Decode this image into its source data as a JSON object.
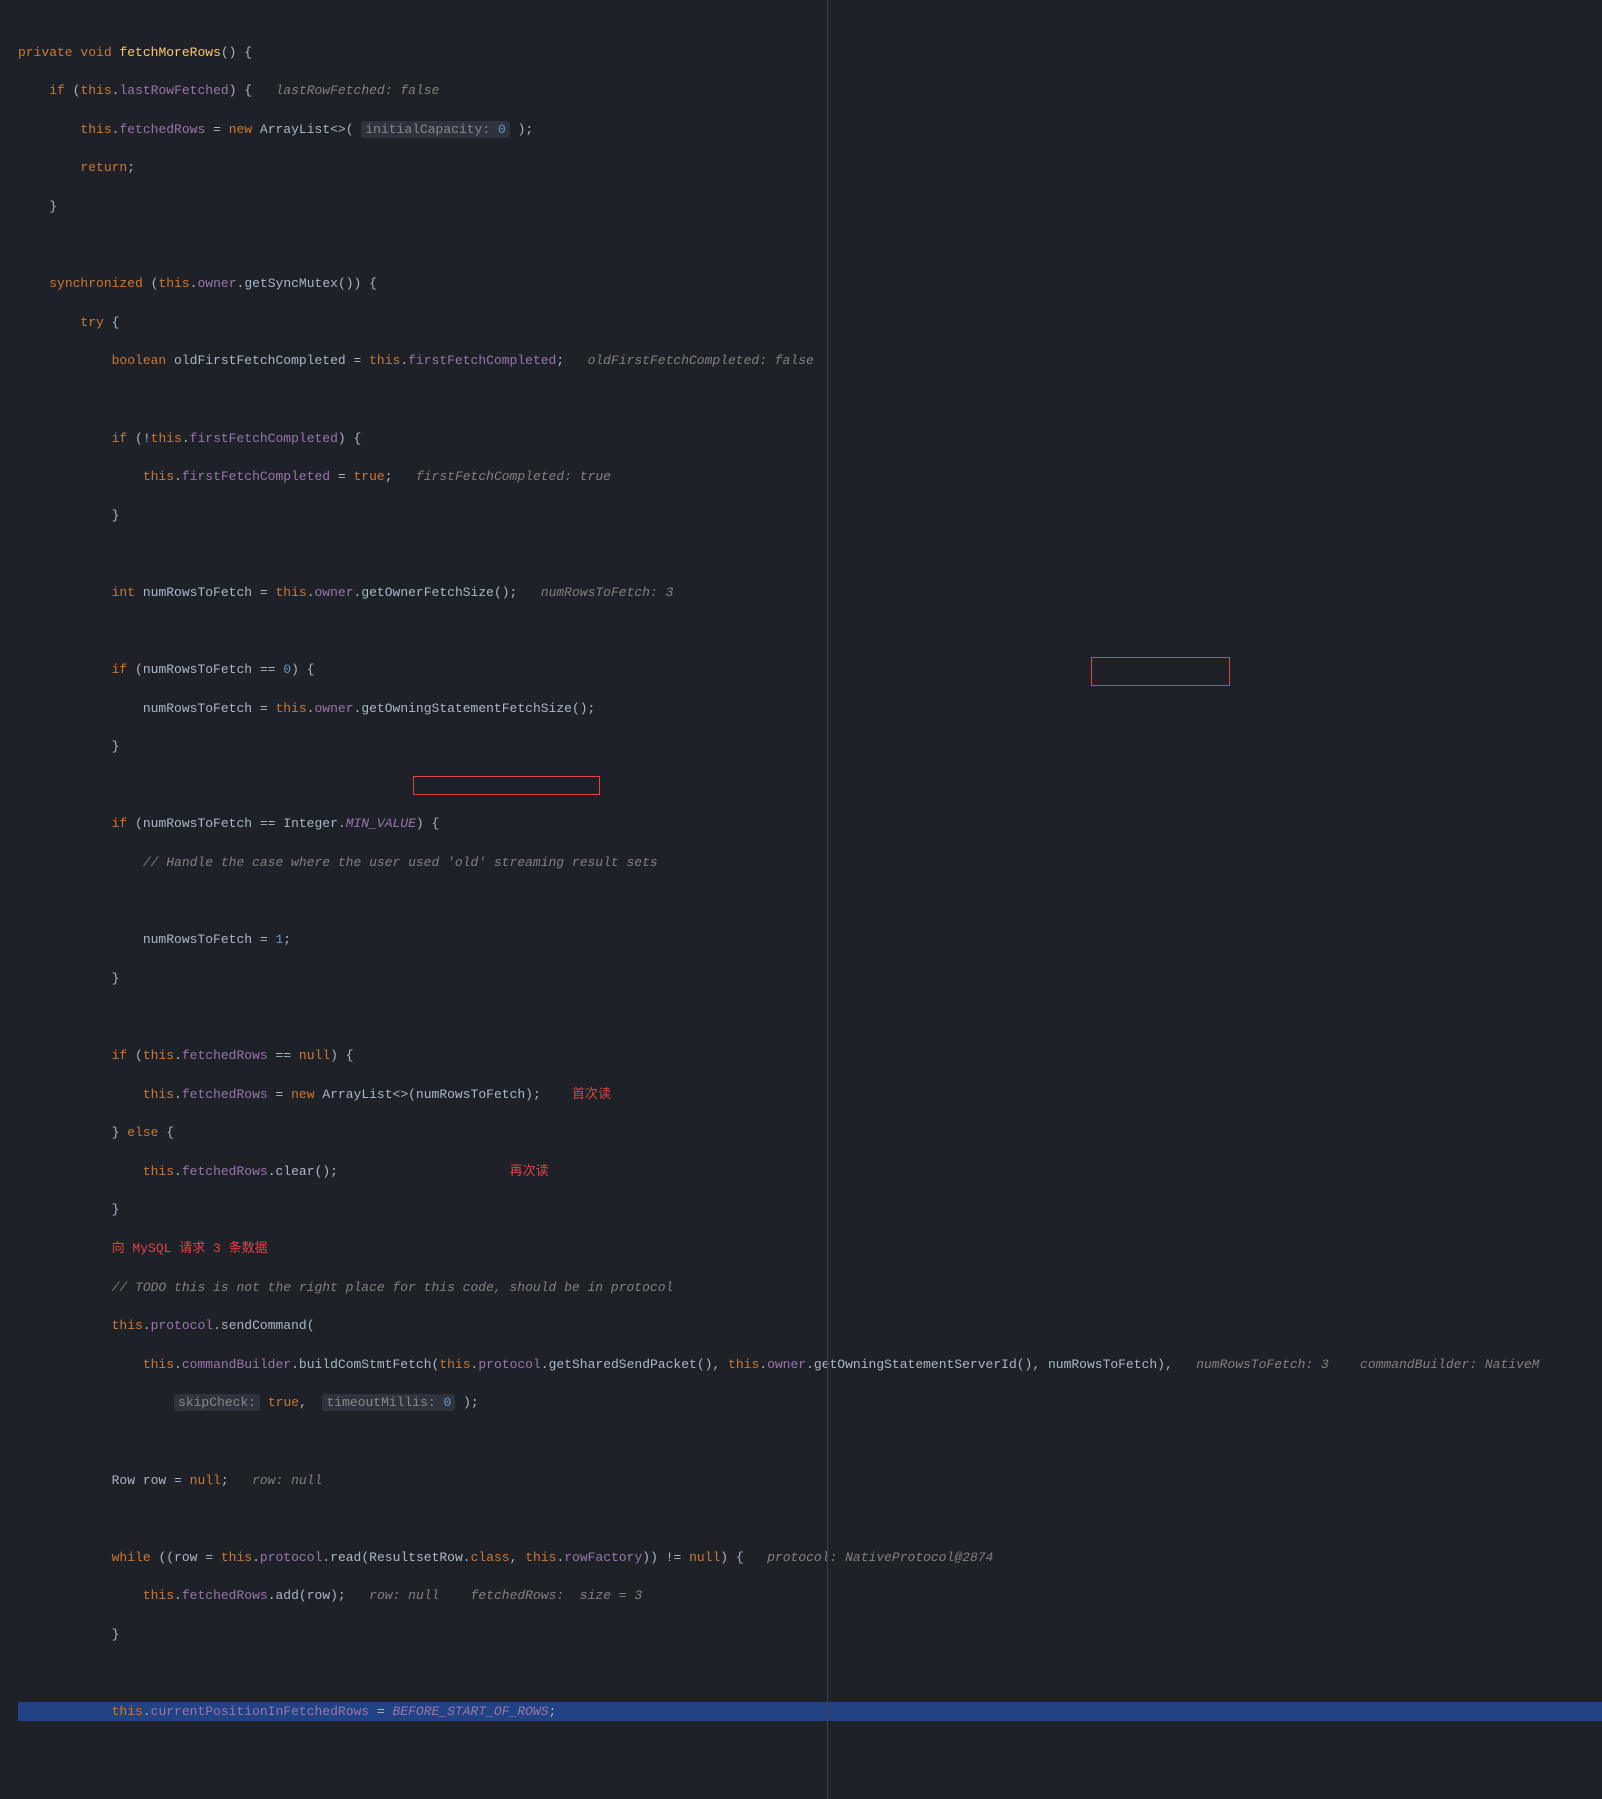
{
  "code": {
    "l1_private": "private",
    "l1_void": "void",
    "l1_method": "fetchMoreRows",
    "l1_paren": "() {",
    "l2_if": "if",
    "l2_this": "this",
    "l2_field": "lastRowFetched",
    "l2_hint": "lastRowFetched: false",
    "l3_this": "this",
    "l3_field": "fetchedRows",
    "l3_new": "new",
    "l3_type": "ArrayList<>(",
    "l3_hint": "initialCapacity:",
    "l3_num": "0",
    "l4_return": "return",
    "l7_sync": "synchronized",
    "l7_this": "this",
    "l7_field": "owner",
    "l7_method": "getSyncMutex",
    "l8_try": "try",
    "l9_bool": "boolean",
    "l9_var": "oldFirstFetchCompleted = ",
    "l9_this": "this",
    "l9_field": "firstFetchCompleted",
    "l9_hint": "oldFirstFetchCompleted: false",
    "l11_if": "if",
    "l11_this": "this",
    "l11_field": "firstFetchCompleted",
    "l12_this": "this",
    "l12_field": "firstFetchCompleted",
    "l12_true": "true",
    "l12_hint": "firstFetchCompleted: ",
    "l12_hint_val": "true",
    "l15_int": "int",
    "l15_var": "numRowsToFetch = ",
    "l15_this": "this",
    "l15_field": "owner",
    "l15_method": "getOwnerFetchSize",
    "l15_hint": "numRowsToFetch: 3",
    "l17_if": "if",
    "l17_cond": "(numRowsToFetch == ",
    "l17_num": "0",
    "l18_var": "numRowsToFetch = ",
    "l18_this": "this",
    "l18_field": "owner",
    "l18_method": "getOwningStatementFetchSize",
    "l21_if": "if",
    "l21_cond": "(numRowsToFetch == Integer.",
    "l21_const": "MIN_VALUE",
    "l22_comment": "// Handle the case where the user used 'old' streaming result sets",
    "l24_var": "numRowsToFetch = ",
    "l24_num": "1",
    "l27_if": "if",
    "l27_this": "this",
    "l27_field": "fetchedRows",
    "l27_null": "null",
    "l28_this": "this",
    "l28_field": "fetchedRows",
    "l28_new": "new",
    "l28_type": "ArrayList<>(numRowsToFetch);",
    "l28_note": "首次读",
    "l29_else": "else",
    "l30_this": "this",
    "l30_field": "fetchedRows",
    "l30_method": "clear",
    "l30_note": "再次读",
    "l32_note": "向 MySQL 请求 3 条数据",
    "l33_comment": "// TODO this is not the right place for this code, should be in protocol",
    "l34_this": "this",
    "l34_field": "protocol",
    "l34_method": "sendCommand",
    "l35_this1": "this",
    "l35_field1": "commandBuilder",
    "l35_method1": "buildComStmtFetch",
    "l35_this2": "this",
    "l35_field2": "protocol",
    "l35_method2": "getSharedSendPacket",
    "l35_this3": "this",
    "l35_field3": "owner",
    "l35_method3": "getOwningStatementServerId",
    "l35_arg": "numRowsToFetch),",
    "l35_hint1": "numRowsToFetch: 3",
    "l35_hint2": "commandBuilder: NativeM",
    "l36_hint1": "skipCheck:",
    "l36_true": "true",
    "l36_hint2": "timeoutMillis:",
    "l36_num": "0",
    "l38_type": "Row row = ",
    "l38_null": "null",
    "l38_hint": "row: null",
    "l40_while": "while",
    "l40_cond1": "((row = ",
    "l40_this1": "this",
    "l40_field1": "protocol",
    "l40_method1": "read",
    "l40_arg1": "ResultsetRow.",
    "l40_class": "class",
    "l40_this2": "this",
    "l40_field2": "rowFactory",
    "l40_null": "null",
    "l40_hint": "protocol: NativeProtocol@2874",
    "l41_this": "this",
    "l41_field": "fetchedRows",
    "l41_method": "add",
    "l41_arg": "row",
    "l41_hint1": "row: null",
    "l41_hint2": "fetchedRows:  size = 3",
    "l44_this": "this",
    "l44_field": "currentPositionInFetchedRows",
    "l44_const": "BEFORE_START_OF_ROWS"
  }
}
